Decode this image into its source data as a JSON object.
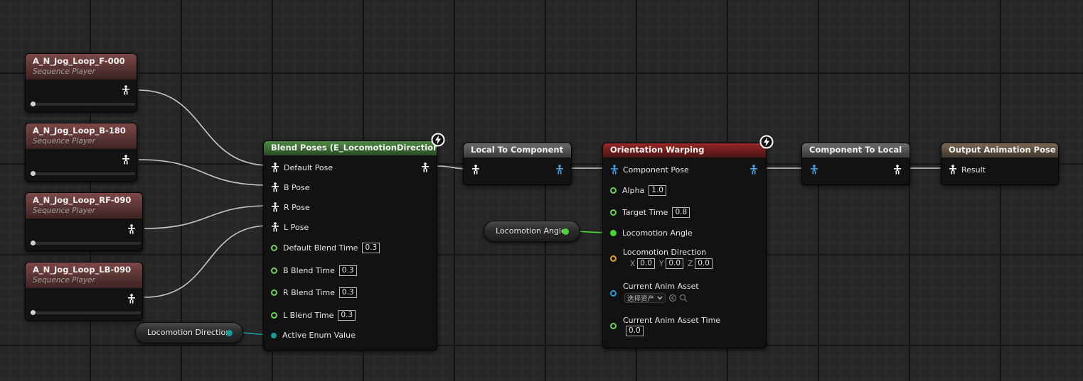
{
  "sequence_players": [
    {
      "name": "A_N_Jog_Loop_F-000",
      "type_label": "Sequence Player"
    },
    {
      "name": "A_N_Jog_Loop_B-180",
      "type_label": "Sequence Player"
    },
    {
      "name": "A_N_Jog_Loop_RF-090",
      "type_label": "Sequence Player"
    },
    {
      "name": "A_N_Jog_Loop_LB-090",
      "type_label": "Sequence Player"
    }
  ],
  "blend_poses": {
    "title": "Blend Poses (E_LocomotionDirection)",
    "default_pose": "Default Pose",
    "b_pose": "B Pose",
    "r_pose": "R Pose",
    "l_pose": "L Pose",
    "default_blend_time_label": "Default Blend Time",
    "default_blend_time": "0.3",
    "b_blend_time_label": "B Blend Time",
    "b_blend_time": "0.3",
    "r_blend_time_label": "R Blend Time",
    "r_blend_time": "0.3",
    "l_blend_time_label": "L Blend Time",
    "l_blend_time": "0.3",
    "active_enum_label": "Active Enum Value"
  },
  "locomotion_direction_getter": "Locomotion Direction",
  "locomotion_angle_getter": "Locomotion Angle",
  "local_to_component": {
    "title": "Local To Component"
  },
  "orientation_warping": {
    "title": "Orientation Warping",
    "component_pose": "Component Pose",
    "alpha_label": "Alpha",
    "alpha": "1.0",
    "target_time_label": "Target Time",
    "target_time": "0.8",
    "locomotion_angle_label": "Locomotion Angle",
    "locomotion_direction_label": "Locomotion Direction",
    "x_label": "X",
    "x": "0.0",
    "y_label": "Y",
    "y": "0.0",
    "z_label": "Z",
    "z": "0.0",
    "current_anim_asset_label": "Current Anim Asset",
    "asset_select": "选择资产",
    "current_anim_asset_time_label": "Current Anim Asset Time",
    "current_anim_asset_time": "0.0"
  },
  "component_to_local": {
    "title": "Component To Local"
  },
  "output_pose": {
    "title": "Output Animation Pose",
    "result": "Result"
  },
  "colors": {
    "pose_wire": "#c8c8c8",
    "float_wire": "#4cd23a",
    "enum_wire": "#1a9a94",
    "component_pose_pin": "#4aa3e8"
  },
  "icons": [
    "pose-icon",
    "component-pose-icon",
    "bolt-icon",
    "float-pin-icon",
    "vector-pin-icon",
    "object-pin-icon",
    "enum-pin-icon",
    "browse-icon",
    "search-icon"
  ]
}
